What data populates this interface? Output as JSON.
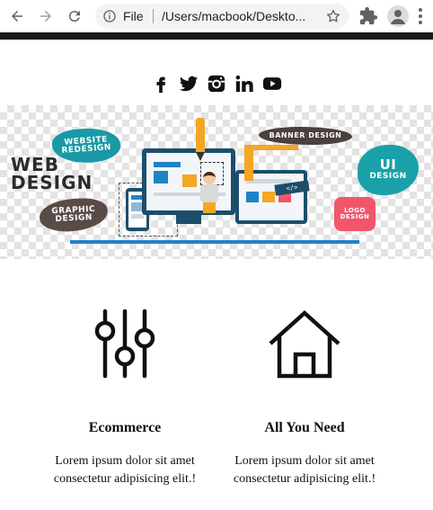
{
  "browser": {
    "file_label": "File",
    "url": "/Users/macbook/Deskto..."
  },
  "social": {
    "icons": [
      "facebook-icon",
      "twitter-icon",
      "instagram-icon",
      "linkedin-icon",
      "youtube-icon"
    ]
  },
  "banner": {
    "web_redesign": "WEBSITE REDESIGN",
    "web_design": "WEB DESIGN",
    "graphic_design": "GRAPHIC DESIGN",
    "banner_design": "BANNER DESIGN",
    "ui": "UI",
    "ui_design": "DESIGN",
    "logo_design": "LOGO DESIGN",
    "code_tag": "</>"
  },
  "features": [
    {
      "icon": "sliders-icon",
      "title": "Ecommerce",
      "text": "Lorem ipsum dolor sit amet consectetur adipisicing elit.!"
    },
    {
      "icon": "home-icon",
      "title": "All You Need",
      "text": "Lorem ipsum dolor sit amet consectetur adipisicing elit.!"
    }
  ],
  "colors": {
    "top_bar": "#1a1a1a",
    "splash_teal": "#1a9aa6",
    "splash_brown": "#5b4b47",
    "splash_pink": "#f2566b",
    "accent_orange": "#f5a623",
    "navy": "#1c4e6b",
    "floor_blue": "#1f83c9"
  }
}
